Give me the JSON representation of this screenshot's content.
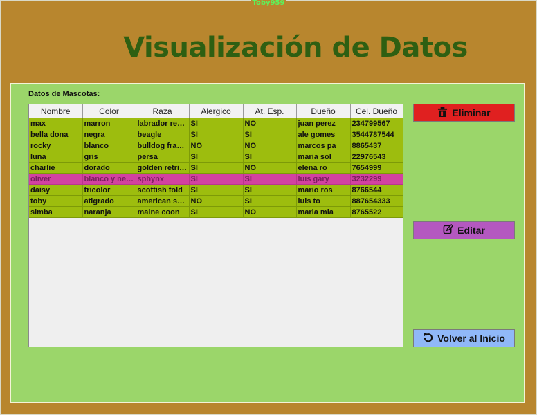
{
  "window": {
    "title": "Toby959"
  },
  "header": {
    "title": "Visualización de Datos"
  },
  "panel": {
    "label": "Datos de Mascotas:"
  },
  "table": {
    "columns": [
      "Nombre",
      "Color",
      "Raza",
      "Alergico",
      "At. Esp.",
      "Dueño",
      "Cel. Dueño"
    ],
    "rows": [
      [
        "max",
        "marron",
        "labrador retriever",
        "SI",
        "NO",
        "juan perez",
        "234799567"
      ],
      [
        "bella dona",
        "negra",
        "beagle",
        "SI",
        "SI",
        "ale gomes",
        "3544787544"
      ],
      [
        "rocky",
        "blanco",
        "bulldog francés",
        "NO",
        "NO",
        "marcos pa",
        "8865437"
      ],
      [
        "luna",
        "gris",
        "persa",
        "SI",
        "SI",
        "maria sol",
        "22976543"
      ],
      [
        "charlie",
        "dorado",
        "golden retriever",
        "SI",
        "NO",
        "elena ro",
        "7654999"
      ],
      [
        "oliver",
        "blanco y negro",
        "sphynx",
        "SI",
        "SI",
        "luis gary",
        "3232299"
      ],
      [
        "daisy",
        "tricolor",
        "scottish fold",
        "SI",
        "SI",
        "mario ros",
        "8766544"
      ],
      [
        "toby",
        "atigrado",
        "american shorthair",
        "NO",
        "SI",
        "luis to",
        "887654333"
      ],
      [
        "simba",
        "naranja",
        "maine coon",
        "SI",
        "NO",
        "maria mia",
        "8765522"
      ]
    ],
    "selected_row_index": 5
  },
  "buttons": {
    "delete_label": "Eliminar",
    "edit_label": "Editar",
    "home_label": "Volver al Inicio"
  },
  "icons": {
    "delete": "trash-icon",
    "edit": "edit-icon",
    "home": "undo-icon"
  },
  "colors": {
    "background": "#b8862e",
    "panel": "#9bd66a",
    "title": "#2e5f12",
    "row": "#9dbd0e",
    "selected_row": "#d242a0",
    "delete_button": "#e02020",
    "edit_button": "#b458c0",
    "home_button": "#90b8f8"
  }
}
